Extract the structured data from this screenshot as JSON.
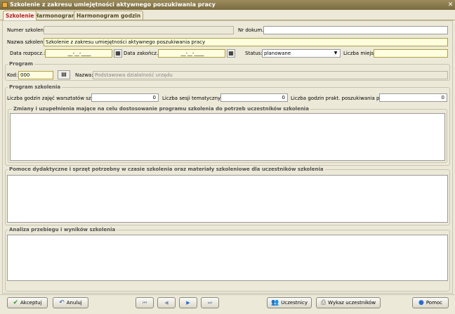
{
  "window": {
    "title": "Szkolenie z zakresu umiejętności aktywnego poszukiwania pracy",
    "close_glyph": "✕"
  },
  "tabs": [
    {
      "label": "Szkolenie",
      "active": true
    },
    {
      "label": "Harmonogram",
      "active": false
    },
    {
      "label": "Harmonogram godzin",
      "active": false
    }
  ],
  "form": {
    "numer_label": "Numer szkolenia:",
    "numer_value": "",
    "nrdok_label": "Nr dokum.:",
    "nrdok_value": "",
    "nazwa_label": "Nazwa szkolenia:",
    "nazwa_value": "Szkolenie z zakresu umiejętności aktywnego poszukiwania pracy",
    "data_rozp_label": "Data rozpocz.:",
    "data_rozp_value": "__-__-____",
    "data_zak_label": "Data zakończ.:",
    "data_zak_value": "__-__-____",
    "status_label": "Status:",
    "status_value": "planowane",
    "liczba_miejsc_label": "Liczba miejsc:",
    "liczba_miejsc_value": ""
  },
  "program": {
    "legend": "Program",
    "kod_label": "Kod:",
    "kod_value": "000",
    "nazwa_label": "Nazwa:",
    "nazwa_value": "Podstawowa działalność urzędu"
  },
  "program_szkolenia": {
    "legend": "Program szkolenia",
    "warsztat_label": "Liczba godzin zajęć warsztatów szkol.:",
    "warsztat_value": "0",
    "sesji_label": "Liczba sesji tematycznych:",
    "sesji_value": "0",
    "prakt_label": "Liczba godzin prakt. poszukiwania pracy:",
    "prakt_value": "0",
    "zmiany_legend": "Zmiany i uzupełnienia mające na celu dostosowanie programu szkolenia do potrzeb uczestników szkolenia"
  },
  "pomoce": {
    "legend": "Pomoce dydaktyczne i sprzęt potrzebny w czasie szkolenia oraz materiały szkoleniowe dla uczestników szkolenia"
  },
  "analiza": {
    "legend": "Analiza przebiegu i wyników szkolenia"
  },
  "buttons": {
    "akceptuj": "Akceptuj",
    "anuluj": "Anuluj",
    "first": "⏮",
    "prev": "◀",
    "next": "▶",
    "last": "⏭",
    "uczestnicy": "Uczestnicy",
    "wykaz": "Wykaz uczestników",
    "pomoc": "Pomoc"
  },
  "colors": {
    "title_bar": "#7a6b40",
    "active_tab": "#c02020",
    "required_field": "#ffffe0"
  }
}
